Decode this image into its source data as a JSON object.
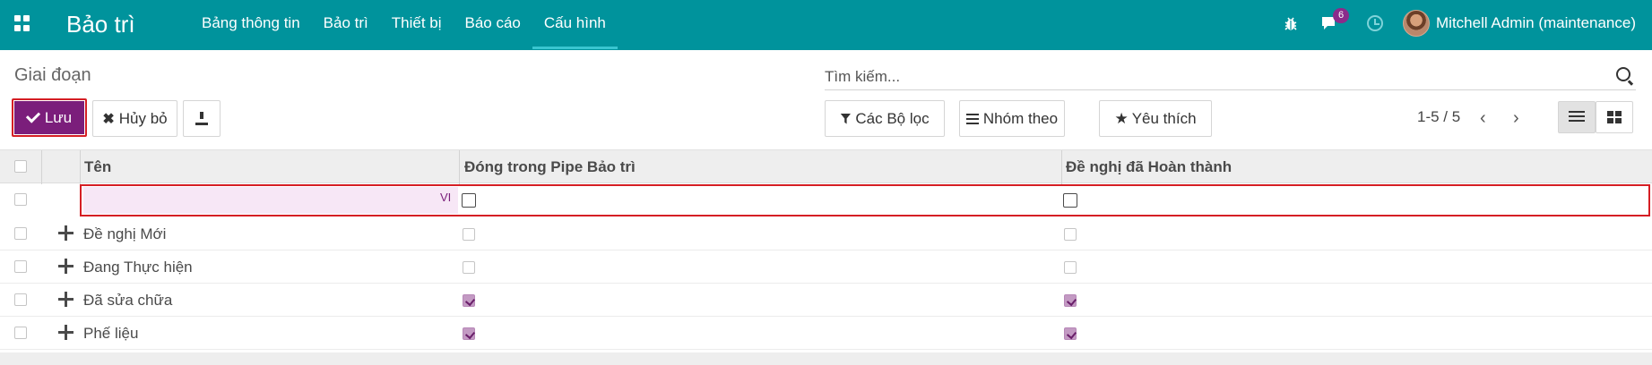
{
  "navbar": {
    "app_title": "Bảo trì",
    "menu": [
      {
        "label": "Bảng thông tin"
      },
      {
        "label": "Bảo trì"
      },
      {
        "label": "Thiết bị"
      },
      {
        "label": "Báo cáo"
      },
      {
        "label": "Cấu hình"
      }
    ],
    "active_menu": "Cấu hình",
    "message_count": "6",
    "user_name": "Mitchell Admin (maintenance)",
    "colors": {
      "bar": "#00939c",
      "badge": "#8b2b8b"
    }
  },
  "control_panel": {
    "breadcrumb": "Giai đoạn",
    "search_placeholder": "Tìm kiếm...",
    "save_label": "Lưu",
    "cancel_label": "Hủy bỏ",
    "filters_label": "Các Bộ lọc",
    "group_by_label": "Nhóm theo",
    "favorites_label": "Yêu thích",
    "pager": "1-5 / 5",
    "pager_prev": "‹",
    "pager_next": "›",
    "colors": {
      "primary": "#7b1e7b",
      "highlight": "#d51e24"
    }
  },
  "table": {
    "headers": {
      "name": "Tên",
      "fold": "Đóng trong Pipe Bảo trì",
      "done": "Đề nghị đã Hoàn thành"
    },
    "new_row": {
      "name_value": "",
      "lang": "VI",
      "fold": false,
      "done": false
    },
    "rows": [
      {
        "name": "Đề nghị Mới",
        "fold": false,
        "done": false
      },
      {
        "name": "Đang Thực hiện",
        "fold": false,
        "done": false
      },
      {
        "name": "Đã sửa chữa",
        "fold": true,
        "done": true
      },
      {
        "name": "Phế liệu",
        "fold": true,
        "done": true
      }
    ]
  }
}
